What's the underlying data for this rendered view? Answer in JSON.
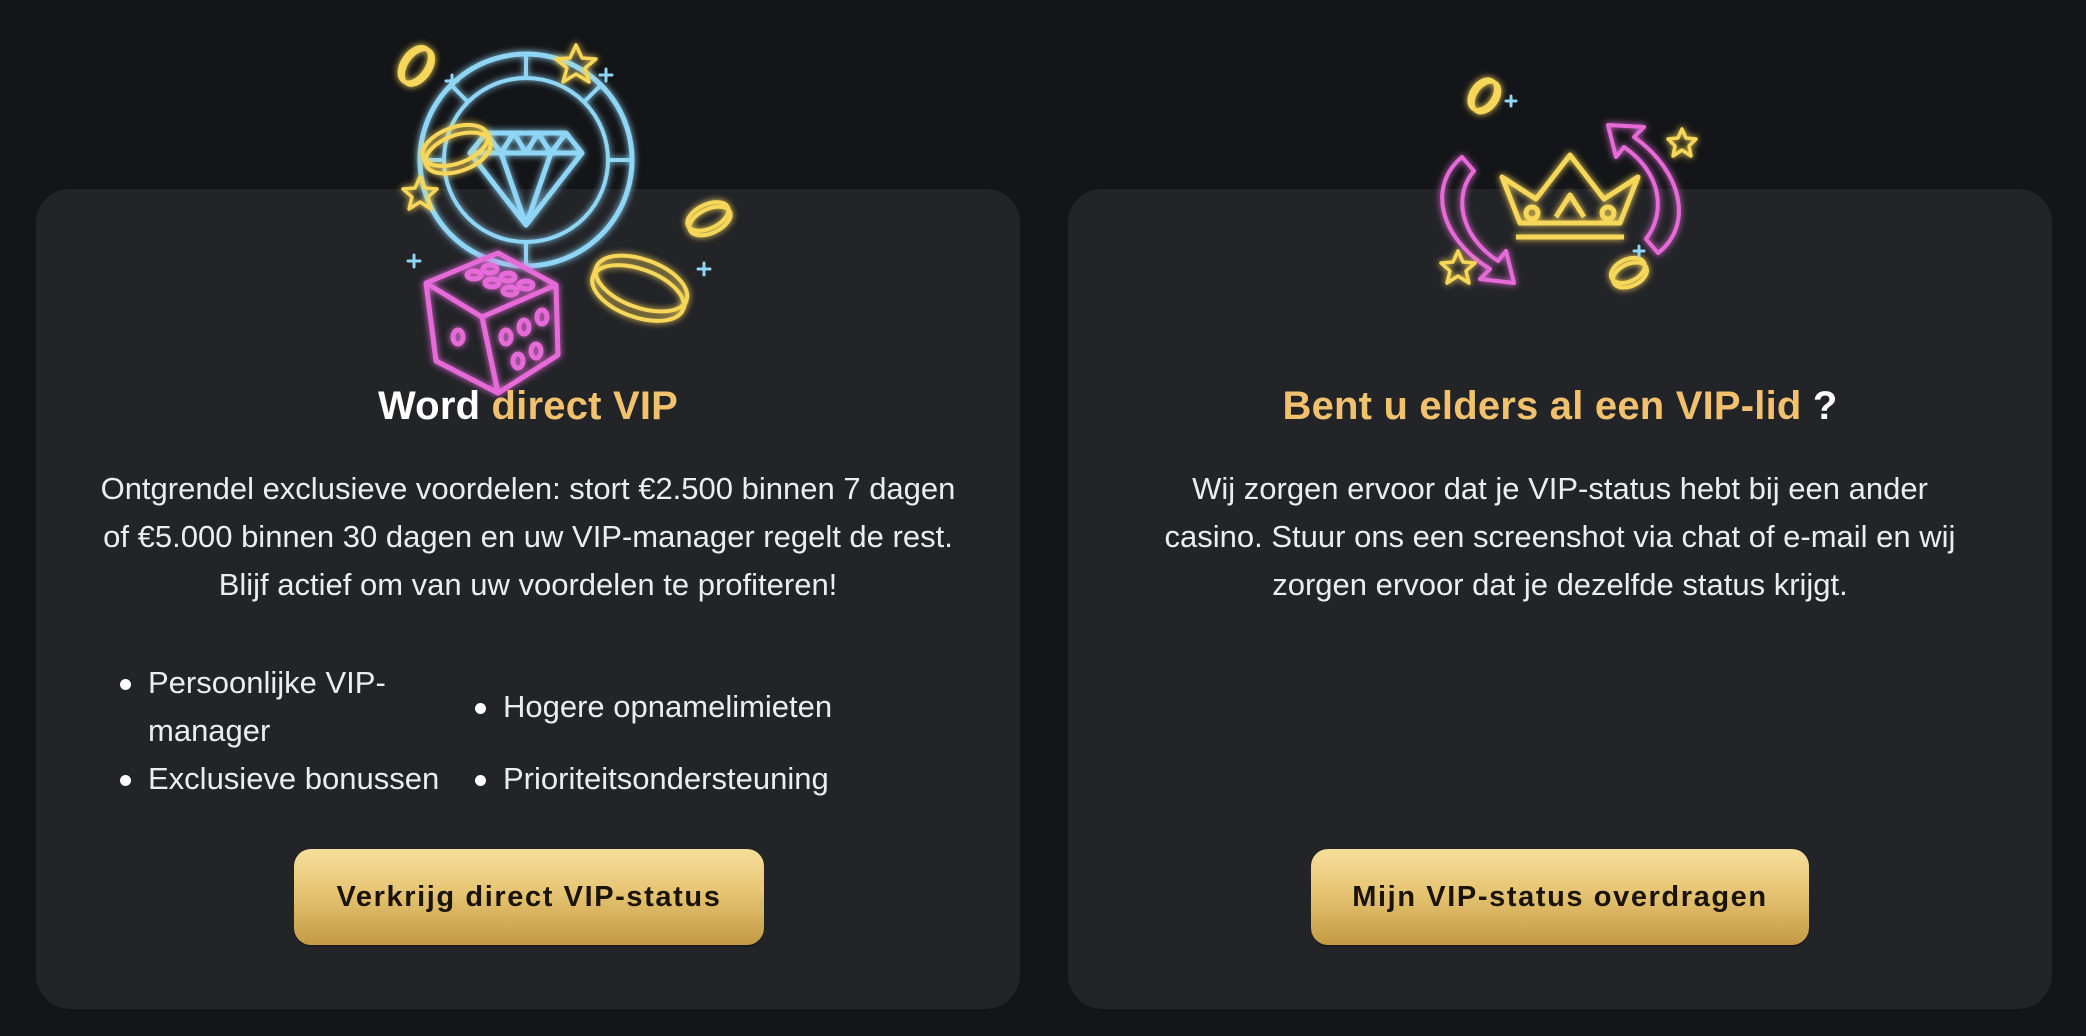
{
  "colors": {
    "page_background": "#141518",
    "card_background": "#232428",
    "accent_gold": "#f2c16e",
    "neon_cyan": "#8fd6f6",
    "neon_pink": "#e66ad8",
    "neon_yellow": "#f7d75a",
    "button_gold": "#e6c473"
  },
  "left_card": {
    "illustration_icons": [
      "casino-chip-icon",
      "diamond-icon",
      "dice-icon",
      "coin-icon",
      "star-icon",
      "sparkle-icon"
    ],
    "title_prefix": "Word ",
    "title_accent": "direct VIP",
    "description": "Ontgrendel exclusieve voordelen: stort €2.500 binnen 7 dagen of €5.000 binnen 30 dagen en uw VIP-manager regelt de rest. Blijf actief om van uw voordelen te profiteren!",
    "bullets": [
      "Persoonlijke VIP-manager",
      "Hogere opnamelimieten",
      "Exclusieve bonussen",
      "Prioriteitsondersteuning"
    ],
    "button_label": "Verkrijg direct VIP-status"
  },
  "right_card": {
    "illustration_icons": [
      "crown-icon",
      "transfer-arrows-icon",
      "coin-icon",
      "star-icon",
      "sparkle-icon"
    ],
    "title_accent": "Bent u elders al een VIP-lid",
    "title_suffix": " ?",
    "description": "Wij zorgen ervoor dat je VIP-status hebt bij een ander casino. Stuur ons een screenshot via chat of e-mail en wij zorgen ervoor dat je dezelfde status krijgt.",
    "button_label": "Mijn VIP-status overdragen"
  }
}
